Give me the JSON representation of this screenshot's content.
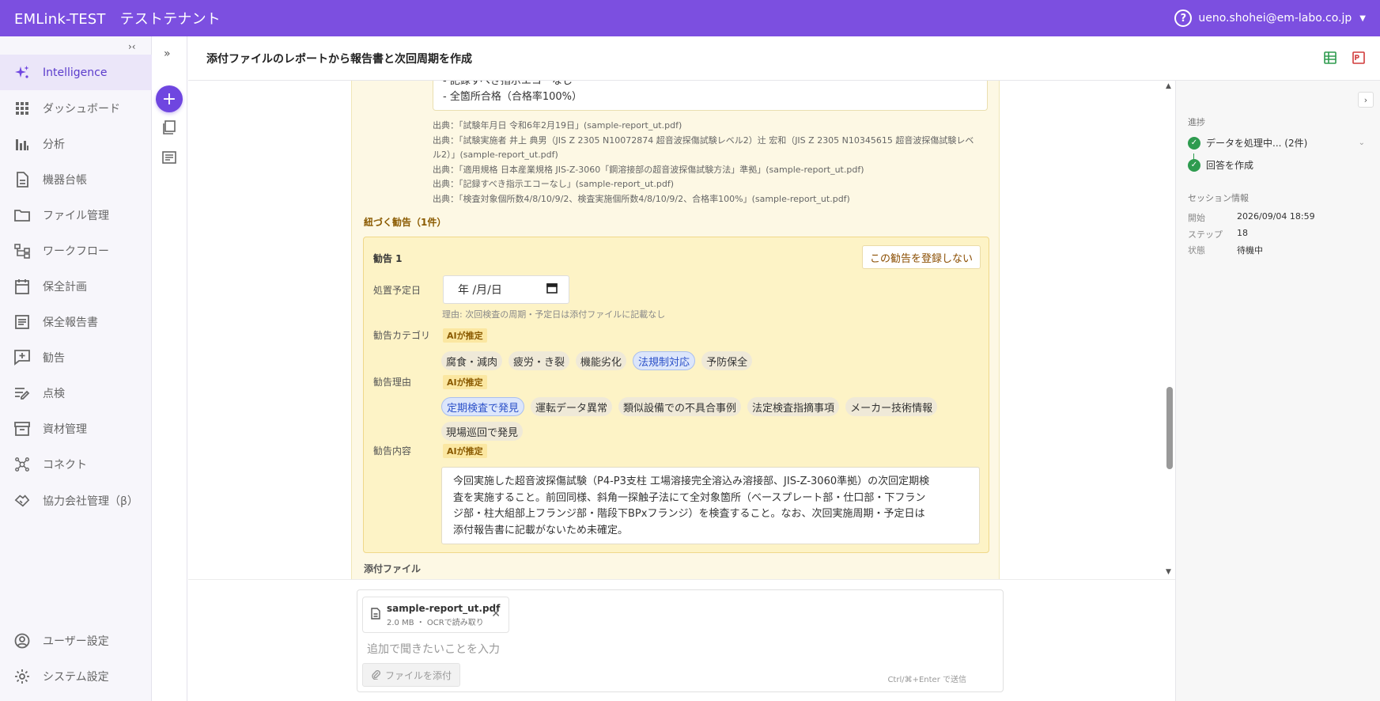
{
  "topbar": {
    "app_name": "EMLink-TEST",
    "tenant": "テストテナント",
    "user_email": "ueno.shohei@em-labo.co.jp",
    "help_glyph": "?"
  },
  "sidebar": {
    "collapse_glyph": "›‹",
    "items": [
      {
        "label": "Intelligence",
        "icon": "sparkle-icon",
        "active": true
      },
      {
        "label": "ダッシュボード",
        "icon": "grid-icon"
      },
      {
        "label": "分析",
        "icon": "bar-chart-icon"
      },
      {
        "label": "機器台帳",
        "icon": "document-icon"
      },
      {
        "label": "ファイル管理",
        "icon": "folder-icon"
      },
      {
        "label": "ワークフロー",
        "icon": "workflow-icon"
      },
      {
        "label": "保全計画",
        "icon": "calendar-icon"
      },
      {
        "label": "保全報告書",
        "icon": "report-icon"
      },
      {
        "label": "勧告",
        "icon": "chat-plus-icon"
      },
      {
        "label": "点検",
        "icon": "checklist-icon"
      },
      {
        "label": "資材管理",
        "icon": "archive-icon"
      },
      {
        "label": "コネクト",
        "icon": "network-icon"
      },
      {
        "label": "協力会社管理（β）",
        "icon": "handshake-icon"
      }
    ],
    "bottom": [
      {
        "label": "ユーザー設定",
        "icon": "user-circle-icon"
      },
      {
        "label": "システム設定",
        "icon": "gear-icon"
      }
    ]
  },
  "header": {
    "title": "添付ファイルのレポートから報告書と次回周期を作成"
  },
  "main": {
    "quote_lines": [
      "- 記録すべき指示エコーなし",
      "- 全箇所合格（合格率100%）"
    ],
    "sources": [
      "出典：「試験年月日 令和6年2月19日」(sample-report_ut.pdf)",
      "出典：「試験実施者 井上 典男（JIS Z 2305 N10072874 超音波探傷試験レベル2）辻 宏和（JIS Z 2305 N10345615 超音波探傷試験レベ",
      "ル2）」(sample-report_ut.pdf)",
      "出典：「適用規格 日本産業規格 JIS-Z-3060「鋼溶接部の超音波探傷試験方法」準拠」(sample-report_ut.pdf)",
      "出典：「記録すべき指示エコーなし」(sample-report_ut.pdf)",
      "出典：「検査対象個所数4/8/10/9/2、検査実施個所数4/8/10/9/2、合格率100%」(sample-report_ut.pdf)"
    ],
    "linked_heading": "紐づく勧告（1件）",
    "recommendation": {
      "title": "勧告 1",
      "no_register_label": "この勧告を登録しない",
      "due_label": "処置予定日",
      "date_placeholder": "年 /月/日",
      "due_reason": "理由: 次回検査の周期・予定日は添付ファイルに記載なし",
      "category_label": "勧告カテゴリ",
      "ai_badge": "AIが推定",
      "categories": [
        {
          "label": "腐食・減肉",
          "selected": false
        },
        {
          "label": "疲労・き裂",
          "selected": false
        },
        {
          "label": "機能劣化",
          "selected": false
        },
        {
          "label": "法規制対応",
          "selected": true
        },
        {
          "label": "予防保全",
          "selected": false
        }
      ],
      "reason_label": "勧告理由",
      "reasons": [
        {
          "label": "定期検査で発見",
          "selected": true
        },
        {
          "label": "運転データ異常",
          "selected": false
        },
        {
          "label": "類似設備での不具合事例",
          "selected": false
        },
        {
          "label": "法定検査指摘事項",
          "selected": false
        },
        {
          "label": "メーカー技術情報",
          "selected": false
        },
        {
          "label": "現場巡回で発見",
          "selected": false
        }
      ],
      "content_label": "勧告内容",
      "content_lines": [
        "今回実施した超音波探傷試験（P4-P3支柱 工場溶接完全溶込み溶接部、JIS-Z-3060準拠）の次回定期検",
        "査を実施すること。前回同様、斜角一探触子法にて全対象箇所（ベースプレート部・仕口部・下フラン",
        "ジ部・柱大組部上フランジ部・階段下BPxフランジ）を検査すること。なお、次回実施周期・予定日は",
        "添付報告書に記載がないため未確定。"
      ]
    },
    "attachments_label": "添付ファイル"
  },
  "composer": {
    "file_name": "sample-report_ut.pdf",
    "file_meta": "2.0 MB ・ OCRで読み取り",
    "placeholder": "追加で聞きたいことを入力",
    "attach_button": "ファイルを添付",
    "send_hint": "Ctrl/⌘+Enter で送信"
  },
  "right_panel": {
    "progress_title": "進捗",
    "steps": [
      "データを処理中... (2件)",
      "回答を作成"
    ],
    "session_title": "セッション情報",
    "session": [
      {
        "key": "開始",
        "value": "2026/09/04 18:59"
      },
      {
        "key": "ステップ",
        "value": "18"
      },
      {
        "key": "状態",
        "value": "待機中"
      }
    ]
  },
  "colors": {
    "brand": "#7c4fe0",
    "accent": "#6f46e0",
    "success": "#2e9b4f",
    "panel_bg": "#fdf8e4",
    "selected_chip": "#dce6fb"
  }
}
